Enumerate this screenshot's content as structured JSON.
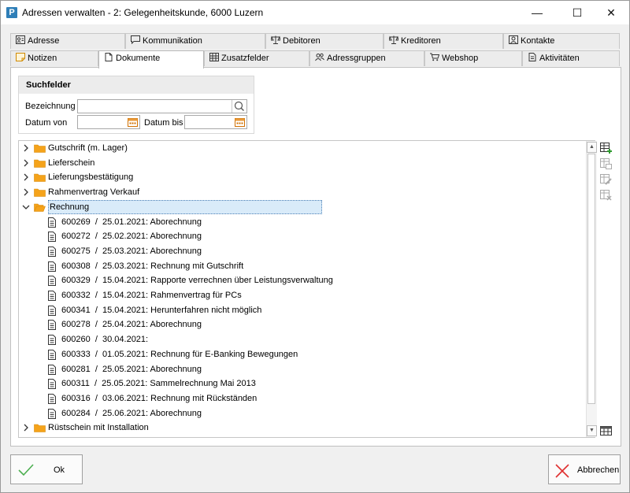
{
  "window": {
    "title": "Adressen verwalten - 2: Gelegenheitskunde, 6000 Luzern",
    "app_icon_letter": "P",
    "minimize_glyph": "—",
    "maximize_glyph": "☐",
    "close_glyph": "✕"
  },
  "tabs_row1": [
    {
      "label": "Adresse",
      "icon": "address-card-icon"
    },
    {
      "label": "Kommunikation",
      "icon": "speech-bubble-icon"
    },
    {
      "label": "Debitoren",
      "icon": "scale-icon"
    },
    {
      "label": "Kreditoren",
      "icon": "scale-icon"
    },
    {
      "label": "Kontakte",
      "icon": "contact-icon"
    }
  ],
  "tabs_row2": [
    {
      "label": "Notizen",
      "icon": "note-icon"
    },
    {
      "label": "Dokumente",
      "icon": "document-icon",
      "active": true
    },
    {
      "label": "Zusatzfelder",
      "icon": "grid-icon"
    },
    {
      "label": "Adressgruppen",
      "icon": "group-icon"
    },
    {
      "label": "Webshop",
      "icon": "cart-icon"
    },
    {
      "label": "Aktivitäten",
      "icon": "activity-icon"
    }
  ],
  "search": {
    "heading": "Suchfelder",
    "bezeichnung_label": "Bezeichnung",
    "bezeichnung_value": "",
    "datum_von_label": "Datum von",
    "datum_von_value": "",
    "datum_bis_label": "Datum bis",
    "datum_bis_value": ""
  },
  "tree": {
    "folders_before": [
      {
        "label": "Gutschrift (m. Lager)",
        "expanded": false
      },
      {
        "label": "Lieferschein",
        "expanded": false
      },
      {
        "label": "Lieferungsbestätigung",
        "expanded": false
      },
      {
        "label": "Rahmenvertrag Verkauf",
        "expanded": false
      }
    ],
    "open_folder": {
      "label": "Rechnung",
      "expanded": true,
      "selected": true
    },
    "documents": [
      "600269  /  25.01.2021: Aborechnung",
      "600272  /  25.02.2021: Aborechnung",
      "600275  /  25.03.2021: Aborechnung",
      "600308  /  25.03.2021: Rechnung mit Gutschrift",
      "600329  /  15.04.2021: Rapporte verrechnen über Leistungsverwaltung",
      "600332  /  15.04.2021: Rahmenvertrag für PCs",
      "600341  /  15.04.2021: Herunterfahren nicht möglich",
      "600278  /  25.04.2021: Aborechnung",
      "600260  /  30.04.2021:",
      "600333  /  01.05.2021: Rechnung für E-Banking Bewegungen",
      "600281  /  25.05.2021: Aborechnung",
      "600311  /  25.05.2021: Sammelrechnung Mai 2013",
      "600316  /  03.06.2021: Rechnung mit Rückständen",
      "600284  /  25.06.2021: Aborechnung"
    ],
    "folders_after": [
      {
        "label": "Rüstschein mit Installation",
        "expanded": false
      }
    ]
  },
  "side_tools": [
    "add-document-icon",
    "copy-document-icon",
    "edit-document-icon",
    "delete-document-icon"
  ],
  "bottom_tool": "table-settings-icon",
  "buttons": {
    "ok_label": "Ok",
    "cancel_label": "Abbrechen"
  },
  "colors": {
    "accent_blue": "#2f7fb8",
    "folder_orange": "#f5a31a",
    "selection_bg": "#d9ebf9",
    "ok_green": "#4caf50",
    "cancel_red": "#e03030"
  }
}
